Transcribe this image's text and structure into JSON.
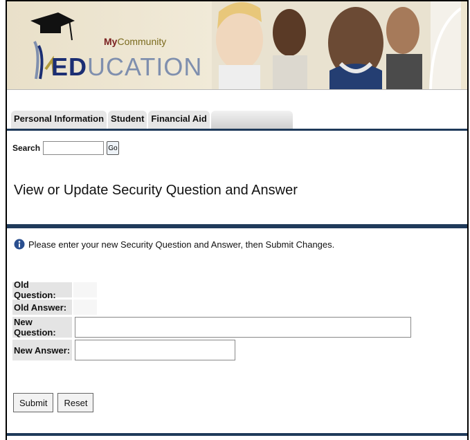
{
  "banner": {
    "logo_my": "My",
    "logo_community": "Community",
    "logo_ed": "ED",
    "logo_ucation": "UCATION"
  },
  "tabs": [
    {
      "label": "Personal Information"
    },
    {
      "label": "Student"
    },
    {
      "label": "Financial Aid"
    },
    {
      "label": ""
    }
  ],
  "search": {
    "label": "Search",
    "value": "",
    "go_label": "Go"
  },
  "page": {
    "title": "View or Update Security Question and Answer",
    "info_text": "Please enter your new Security Question and Answer, then Submit Changes."
  },
  "form": {
    "old_question_label": "Old Question:",
    "old_answer_label": "Old Answer:",
    "new_question_label": "New Question:",
    "new_answer_label": "New Answer:",
    "new_question_value": "",
    "new_answer_value": ""
  },
  "buttons": {
    "submit_label": "Submit",
    "reset_label": "Reset"
  },
  "colors": {
    "rule": "#1f3a5a",
    "logo_dark": "#1b2e73",
    "logo_light": "#7f8fae"
  }
}
